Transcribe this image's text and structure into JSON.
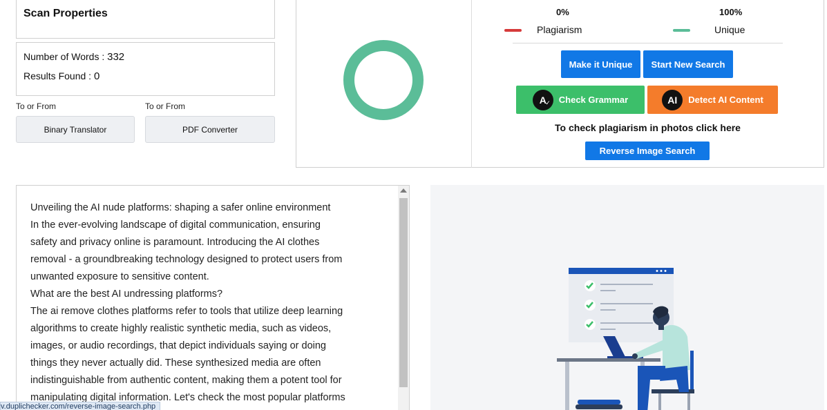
{
  "scan_properties": {
    "title": "Scan Properties",
    "words_label": "Number of Words :",
    "words_value": "332",
    "results_label": "Results Found :",
    "results_value": "0"
  },
  "tools": [
    {
      "caption": "To or From",
      "label": "Binary Translator"
    },
    {
      "caption": "To or From",
      "label": "PDF Converter"
    }
  ],
  "result": {
    "plagiarism_pct": "0%",
    "unique_pct": "100%",
    "plagiarism_label": "Plagiarism",
    "unique_label": "Unique",
    "plagiarism_fraction": 0,
    "unique_fraction": 1,
    "colors": {
      "plagiarism": "#d63b3b",
      "unique": "#5bbd98",
      "blue": "#1178e6",
      "green": "#3cbf6a",
      "orange": "#f47c2b"
    }
  },
  "actions": {
    "make_unique": "Make it Unique",
    "start_new": "Start New Search",
    "check_grammar": "Check Grammar",
    "detect_ai": "Detect AI Content",
    "photo_hint": "To check plagiarism in photos click here",
    "reverse_image": "Reverse Image Search"
  },
  "icons": {
    "grammar": "grammar-check-icon",
    "ai": "ai-detector-icon"
  },
  "text_lines": [
    "Unveiling the AI nude platforms: shaping a safer online environment",
    "In the ever-evolving landscape of digital communication, ensuring",
    "safety and privacy online is paramount. Introducing the AI clothes",
    "removal - a groundbreaking technology designed to protect users from",
    "unwanted exposure to sensitive content.",
    "What are the best AI undressing platforms?",
    "The ai remove clothes platforms refer to tools that utilize deep learning",
    "algorithms to create highly realistic synthetic media, such as videos,",
    "images, or audio recordings, that depict individuals saying or doing",
    "things they never actually did. These synthesized media are often",
    "indistinguishable from authentic content, making them a potent tool for",
    "manipulating digital information. Let's check the most popular platforms"
  ],
  "status_url": "v.duplichecker.com/reverse-image-search.php"
}
